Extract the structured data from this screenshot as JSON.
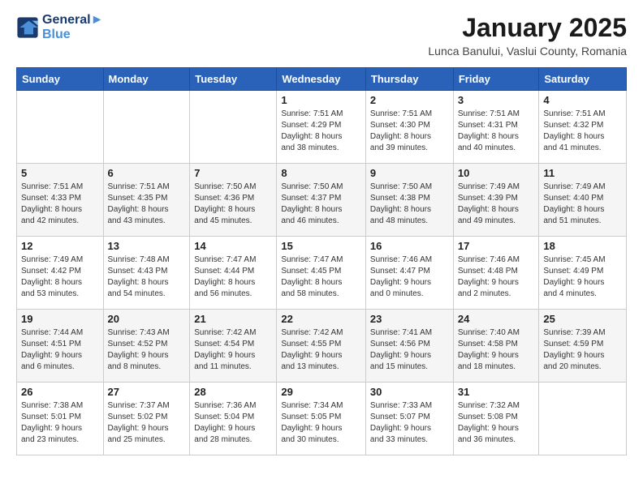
{
  "header": {
    "logo_line1": "General",
    "logo_line2": "Blue",
    "month_title": "January 2025",
    "subtitle": "Lunca Banului, Vaslui County, Romania"
  },
  "weekdays": [
    "Sunday",
    "Monday",
    "Tuesday",
    "Wednesday",
    "Thursday",
    "Friday",
    "Saturday"
  ],
  "weeks": [
    [
      {
        "day": "",
        "info": ""
      },
      {
        "day": "",
        "info": ""
      },
      {
        "day": "",
        "info": ""
      },
      {
        "day": "1",
        "info": "Sunrise: 7:51 AM\nSunset: 4:29 PM\nDaylight: 8 hours\nand 38 minutes."
      },
      {
        "day": "2",
        "info": "Sunrise: 7:51 AM\nSunset: 4:30 PM\nDaylight: 8 hours\nand 39 minutes."
      },
      {
        "day": "3",
        "info": "Sunrise: 7:51 AM\nSunset: 4:31 PM\nDaylight: 8 hours\nand 40 minutes."
      },
      {
        "day": "4",
        "info": "Sunrise: 7:51 AM\nSunset: 4:32 PM\nDaylight: 8 hours\nand 41 minutes."
      }
    ],
    [
      {
        "day": "5",
        "info": "Sunrise: 7:51 AM\nSunset: 4:33 PM\nDaylight: 8 hours\nand 42 minutes."
      },
      {
        "day": "6",
        "info": "Sunrise: 7:51 AM\nSunset: 4:35 PM\nDaylight: 8 hours\nand 43 minutes."
      },
      {
        "day": "7",
        "info": "Sunrise: 7:50 AM\nSunset: 4:36 PM\nDaylight: 8 hours\nand 45 minutes."
      },
      {
        "day": "8",
        "info": "Sunrise: 7:50 AM\nSunset: 4:37 PM\nDaylight: 8 hours\nand 46 minutes."
      },
      {
        "day": "9",
        "info": "Sunrise: 7:50 AM\nSunset: 4:38 PM\nDaylight: 8 hours\nand 48 minutes."
      },
      {
        "day": "10",
        "info": "Sunrise: 7:49 AM\nSunset: 4:39 PM\nDaylight: 8 hours\nand 49 minutes."
      },
      {
        "day": "11",
        "info": "Sunrise: 7:49 AM\nSunset: 4:40 PM\nDaylight: 8 hours\nand 51 minutes."
      }
    ],
    [
      {
        "day": "12",
        "info": "Sunrise: 7:49 AM\nSunset: 4:42 PM\nDaylight: 8 hours\nand 53 minutes."
      },
      {
        "day": "13",
        "info": "Sunrise: 7:48 AM\nSunset: 4:43 PM\nDaylight: 8 hours\nand 54 minutes."
      },
      {
        "day": "14",
        "info": "Sunrise: 7:47 AM\nSunset: 4:44 PM\nDaylight: 8 hours\nand 56 minutes."
      },
      {
        "day": "15",
        "info": "Sunrise: 7:47 AM\nSunset: 4:45 PM\nDaylight: 8 hours\nand 58 minutes."
      },
      {
        "day": "16",
        "info": "Sunrise: 7:46 AM\nSunset: 4:47 PM\nDaylight: 9 hours\nand 0 minutes."
      },
      {
        "day": "17",
        "info": "Sunrise: 7:46 AM\nSunset: 4:48 PM\nDaylight: 9 hours\nand 2 minutes."
      },
      {
        "day": "18",
        "info": "Sunrise: 7:45 AM\nSunset: 4:49 PM\nDaylight: 9 hours\nand 4 minutes."
      }
    ],
    [
      {
        "day": "19",
        "info": "Sunrise: 7:44 AM\nSunset: 4:51 PM\nDaylight: 9 hours\nand 6 minutes."
      },
      {
        "day": "20",
        "info": "Sunrise: 7:43 AM\nSunset: 4:52 PM\nDaylight: 9 hours\nand 8 minutes."
      },
      {
        "day": "21",
        "info": "Sunrise: 7:42 AM\nSunset: 4:54 PM\nDaylight: 9 hours\nand 11 minutes."
      },
      {
        "day": "22",
        "info": "Sunrise: 7:42 AM\nSunset: 4:55 PM\nDaylight: 9 hours\nand 13 minutes."
      },
      {
        "day": "23",
        "info": "Sunrise: 7:41 AM\nSunset: 4:56 PM\nDaylight: 9 hours\nand 15 minutes."
      },
      {
        "day": "24",
        "info": "Sunrise: 7:40 AM\nSunset: 4:58 PM\nDaylight: 9 hours\nand 18 minutes."
      },
      {
        "day": "25",
        "info": "Sunrise: 7:39 AM\nSunset: 4:59 PM\nDaylight: 9 hours\nand 20 minutes."
      }
    ],
    [
      {
        "day": "26",
        "info": "Sunrise: 7:38 AM\nSunset: 5:01 PM\nDaylight: 9 hours\nand 23 minutes."
      },
      {
        "day": "27",
        "info": "Sunrise: 7:37 AM\nSunset: 5:02 PM\nDaylight: 9 hours\nand 25 minutes."
      },
      {
        "day": "28",
        "info": "Sunrise: 7:36 AM\nSunset: 5:04 PM\nDaylight: 9 hours\nand 28 minutes."
      },
      {
        "day": "29",
        "info": "Sunrise: 7:34 AM\nSunset: 5:05 PM\nDaylight: 9 hours\nand 30 minutes."
      },
      {
        "day": "30",
        "info": "Sunrise: 7:33 AM\nSunset: 5:07 PM\nDaylight: 9 hours\nand 33 minutes."
      },
      {
        "day": "31",
        "info": "Sunrise: 7:32 AM\nSunset: 5:08 PM\nDaylight: 9 hours\nand 36 minutes."
      },
      {
        "day": "",
        "info": ""
      }
    ]
  ]
}
